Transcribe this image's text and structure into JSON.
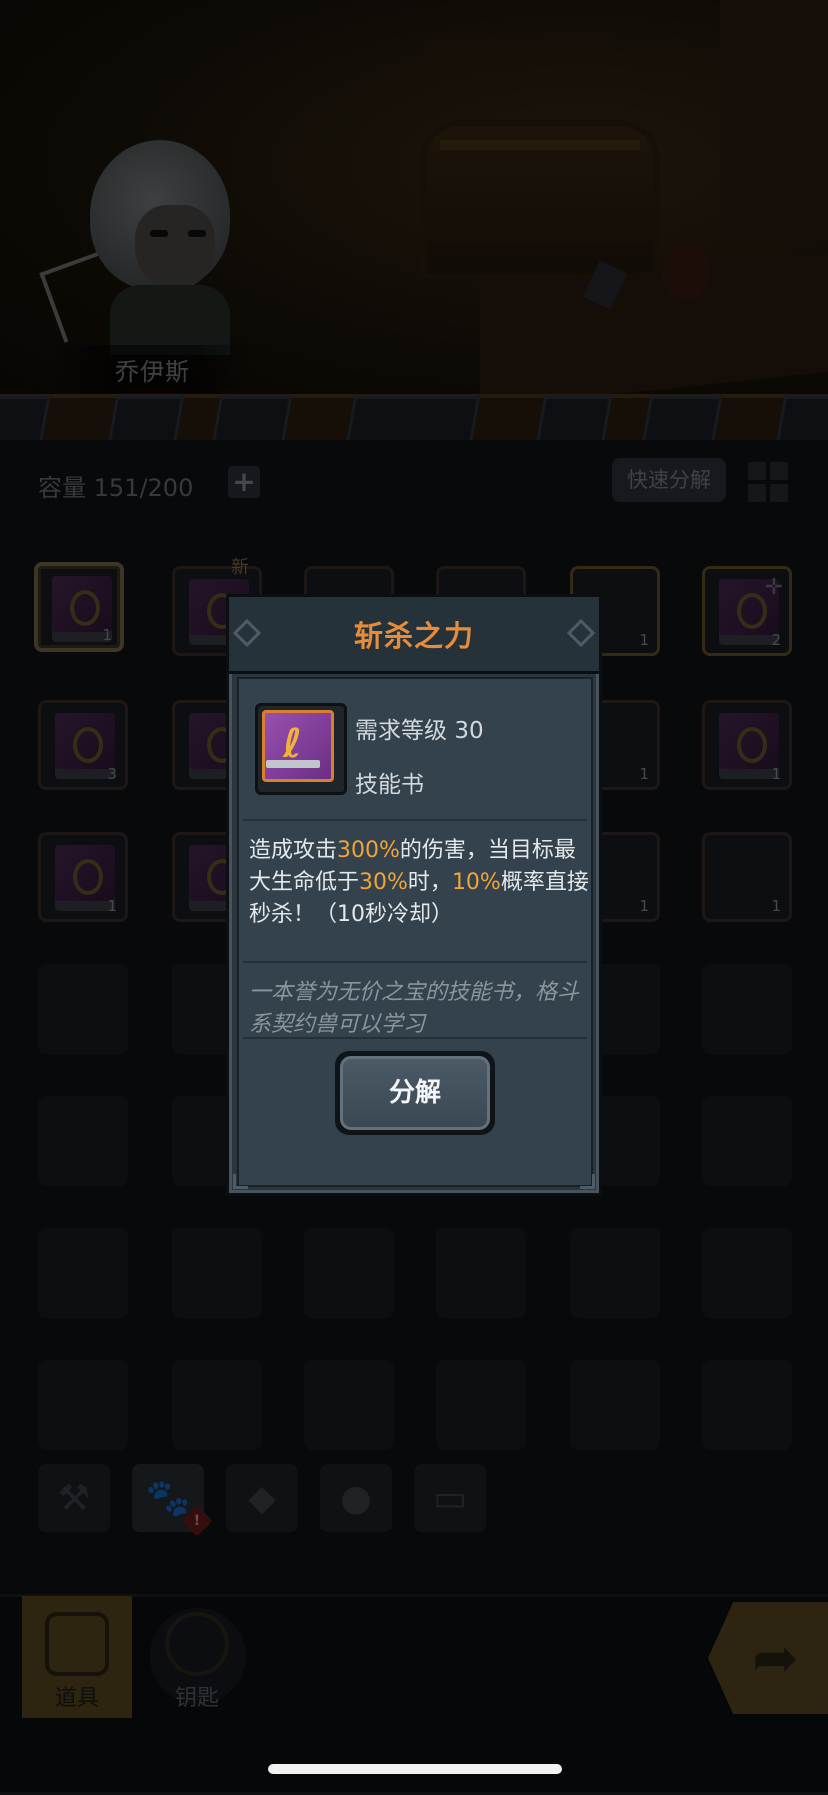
{
  "scene": {
    "hero_name": "乔伊斯"
  },
  "inventory": {
    "capacity_label": "容量",
    "capacity_value": "151/200",
    "add_capacity_symbol": "+",
    "quick_decompose_label": "快速分解",
    "new_tag": "新",
    "slot_counts": [
      "1",
      "1",
      "2",
      "3",
      "1",
      "1",
      "1",
      "1",
      "1"
    ]
  },
  "bottom_nav": {
    "items_label": "道具",
    "keys_label": "钥匙",
    "alert_symbol": "!",
    "next_symbol": "➦"
  },
  "modal": {
    "title": "斩杀之力",
    "required_level_label": "需求等级",
    "required_level_value": "30",
    "item_type": "技能书",
    "desc_part1": "造成攻击",
    "desc_hl1": "300%",
    "desc_part2": "的伤害，当目标最大生命低于",
    "desc_hl2": "30%",
    "desc_part3": "时，",
    "desc_hl3": "10%",
    "desc_part4": "概率直接秒杀！（10秒冷却）",
    "flavor_text": "一本誉为无价之宝的技能书，格斗系契约兽可以学习",
    "decompose_label": "分解"
  },
  "colors": {
    "title_orange": "#e58d3b",
    "highlight_orange": "#f0a43a",
    "modal_bg": "#2a353d"
  }
}
